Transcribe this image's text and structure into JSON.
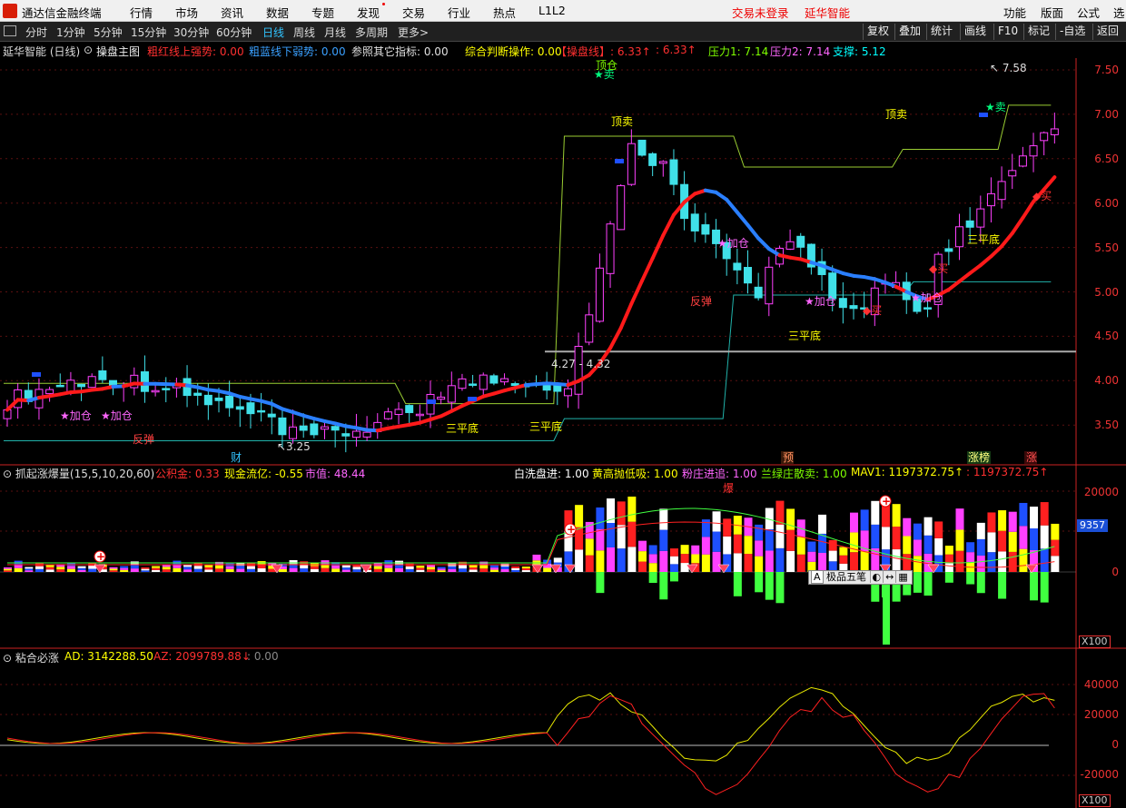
{
  "menubar": {
    "app_title": "通达信金融终端",
    "items": [
      "行情",
      "市场",
      "资讯",
      "数据",
      "专题",
      "发现",
      "交易",
      "行业",
      "热点",
      "L1L2"
    ],
    "login_status": "交易未登录",
    "brand": "延华智能",
    "right_items": [
      "功能",
      "版面",
      "公式",
      "选"
    ]
  },
  "toolbar": {
    "periods": [
      "分时",
      "1分钟",
      "5分钟",
      "15分钟",
      "30分钟",
      "60分钟",
      "日线",
      "周线",
      "月线",
      "多周期",
      "更多>"
    ],
    "active_period": "日线",
    "right_buttons": [
      "复权",
      "叠加",
      "统计",
      "画线",
      "F10",
      "标记",
      "-自选",
      "返回"
    ]
  },
  "main_panel": {
    "stock_title": "延华智能 (日线)",
    "indicator_name": "操盘主图",
    "fields": [
      {
        "label": "粗红线上强势: 0.00",
        "color": "#ff3030"
      },
      {
        "label": "粗蓝线下弱势: 0.00",
        "color": "#3aa0ff"
      },
      {
        "label": "参照其它指标: 0.00",
        "color": "#e0e0e0"
      },
      {
        "label": "综合判断操作: 0.00",
        "color": "#ffff00"
      },
      {
        "label": "【操盘线】: 6.33↑",
        "color": "#ff3030"
      },
      {
        "label": ": 6.33↑",
        "color": "#ff3030"
      },
      {
        "label": "压力1: 7.14",
        "color": "#7fff00"
      },
      {
        "label": "压力2: 7.14",
        "color": "#ff66ff"
      },
      {
        "label": "支撑: 5.12",
        "color": "#00ffff"
      }
    ],
    "y_ticks": [
      "7.50",
      "7.00",
      "6.50",
      "6.00",
      "5.50",
      "5.00",
      "4.50",
      "4.00",
      "3.50"
    ],
    "annotations": {
      "high": "7.58",
      "low": "3.25",
      "range_label": "4.27 - 4.32",
      "top_sell": "顶仓",
      "sell": "卖",
      "top_sell2": "顶卖",
      "add": "加仓",
      "rebound": "反弹",
      "flat_bottom": "三平底",
      "buy": "买",
      "fin": "财",
      "pre": "预",
      "up": "涨",
      "hot": "涨榜"
    }
  },
  "volume_panel": {
    "title": "抓起涨爆量(15,5,10,20,60)",
    "fields_left": [
      {
        "label": "公积金: 0.33",
        "color": "#ff3030"
      },
      {
        "label": "现金流亿: -0.55",
        "color": "#ffff00"
      },
      {
        "label": "市值: 48.44",
        "color": "#ff66ff"
      }
    ],
    "fields_right": [
      {
        "label": "白洗盘进: 1.00",
        "color": "#ffffff"
      },
      {
        "label": "黄高抛低吸: 1.00",
        "color": "#ffff00"
      },
      {
        "label": "粉庄进追: 1.00",
        "color": "#ff66ff"
      },
      {
        "label": "兰绿庄散卖: 1.00",
        "color": "#7fff00"
      },
      {
        "label": "MAV1: 1197372.75↑",
        "color": "#ffff00"
      },
      {
        "label": ": 1197372.75↑",
        "color": "#ff3030"
      }
    ],
    "y_ticks": [
      "20000",
      "0"
    ],
    "current_tag": "9357",
    "unit": "X100",
    "burst": "爆",
    "popup": "极品五笔"
  },
  "osc_panel": {
    "title": "粘合必涨",
    "fields": [
      {
        "label": "AD: 3142288.50",
        "color": "#ffff00"
      },
      {
        "label": "AZ: 2099789.88↓",
        "color": "#ff3030"
      },
      {
        "label": ": 0.00",
        "color": "#888888"
      }
    ],
    "y_ticks": [
      "40000",
      "20000",
      "0",
      "-20000"
    ],
    "unit": "X100"
  },
  "colors": {
    "up": "#ff40ff",
    "down": "#40e0e8",
    "ma_red": "#ff1a1a",
    "ma_blue": "#2a7fff",
    "axis": "#e33"
  }
}
